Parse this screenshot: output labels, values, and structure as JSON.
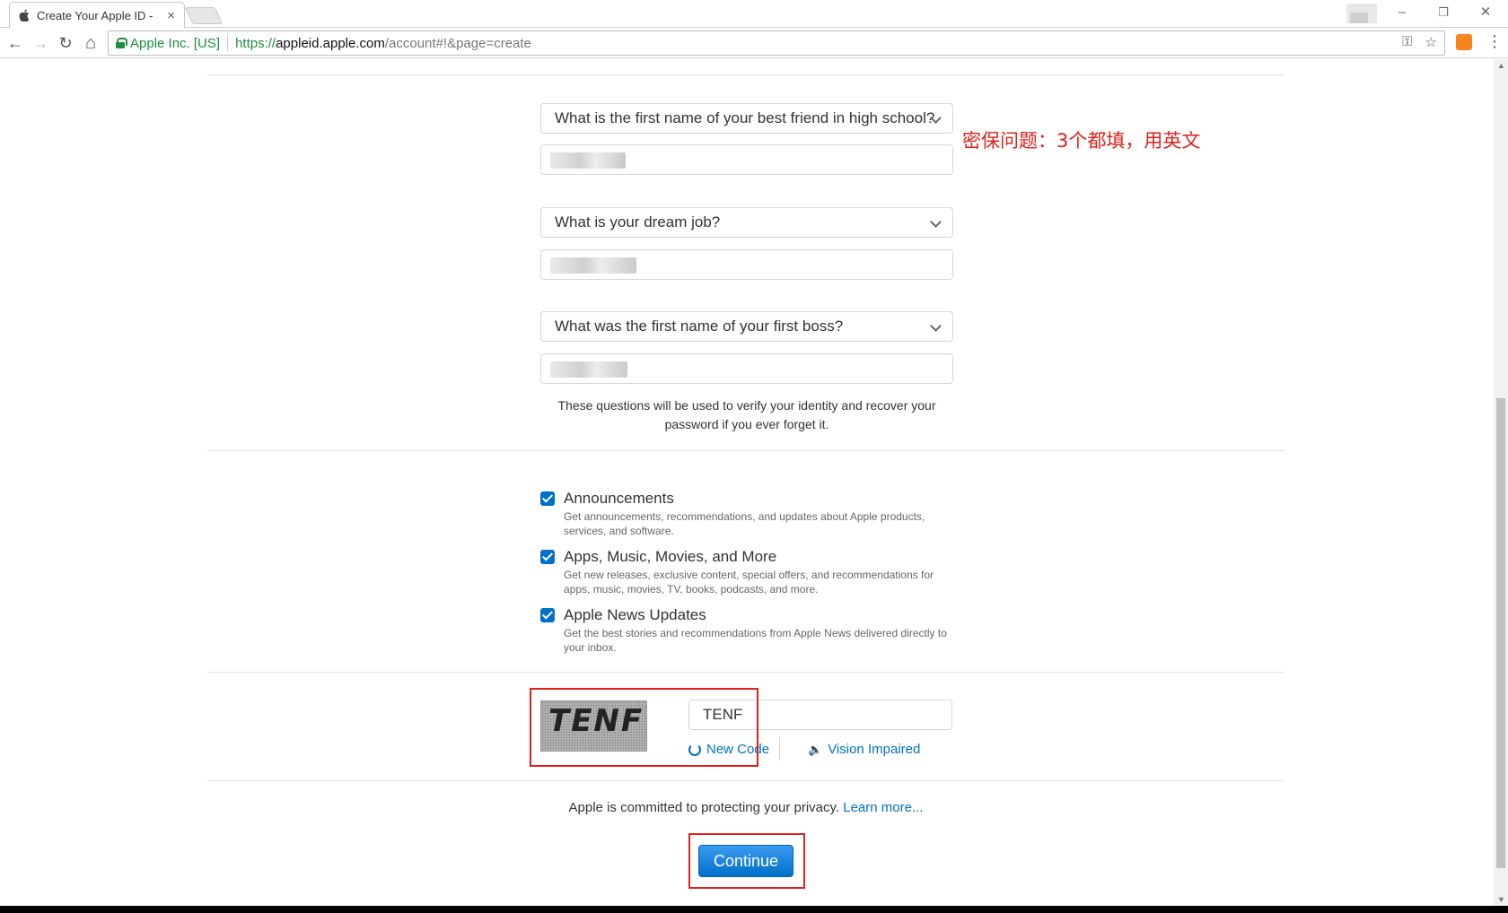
{
  "browser": {
    "tab_title": "Create Your Apple ID -",
    "tab_close": "×",
    "security_label": "Apple Inc. [US]",
    "url_protocol": "https://",
    "url_host": "appleid.apple.com",
    "url_path": "/account#!&page=create",
    "window_controls": {
      "minimize": "–",
      "restore": "❐",
      "close": "✕"
    },
    "nav": {
      "back": "←",
      "forward": "→",
      "reload": "↻",
      "home": "⌂"
    },
    "omnibox_icons": {
      "key": "⚿",
      "star": "☆"
    }
  },
  "security_questions": [
    {
      "question": "What is the first name of your best friend in high school?"
    },
    {
      "question": "What is your dream job?"
    },
    {
      "question": "What was the first name of your first boss?"
    }
  ],
  "annotation": "密保问题：3个都填，用英文",
  "help_text": "These questions will be used to verify your identity and recover your password if you ever forget it.",
  "subscriptions": [
    {
      "title": "Announcements",
      "description": "Get announcements, recommendations, and updates about Apple products, services, and software.",
      "checked": true
    },
    {
      "title": "Apps, Music, Movies, and More",
      "description": "Get new releases, exclusive content, special offers, and recommendations for apps, music, movies, TV, books, podcasts, and more.",
      "checked": true
    },
    {
      "title": "Apple News Updates",
      "description": "Get the best stories and recommendations from Apple News delivered directly to your inbox.",
      "checked": true
    }
  ],
  "captcha": {
    "image_text": "TENF",
    "input_value": "TENF",
    "new_code": "New Code",
    "vision_impaired": "Vision Impaired"
  },
  "privacy": {
    "text": "Apple is committed to protecting your privacy.",
    "link": "Learn more..."
  },
  "continue_label": "Continue",
  "colors": {
    "accent": "#0070c9",
    "annotation_red": "#e0201a",
    "secure_green": "#1e8e3e"
  }
}
